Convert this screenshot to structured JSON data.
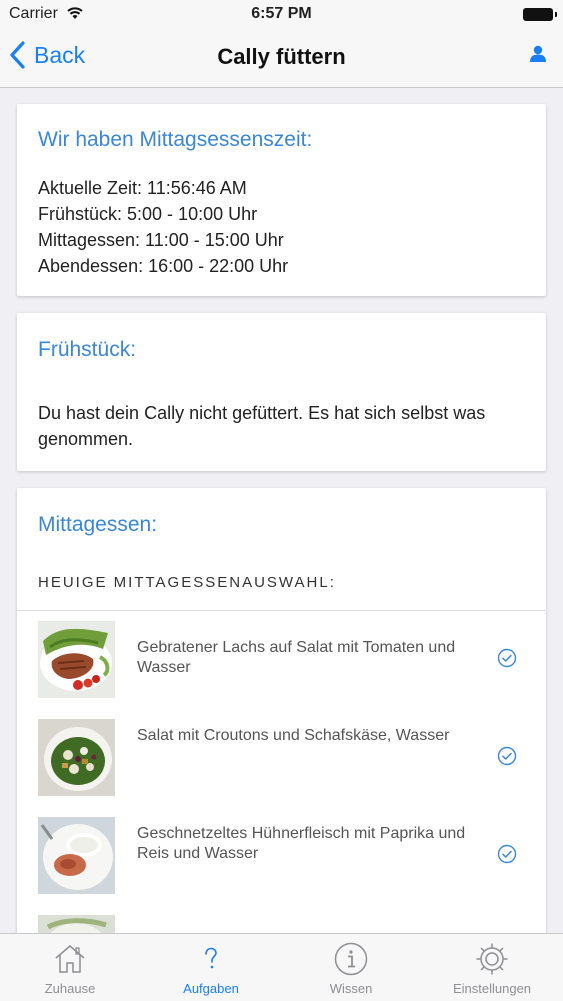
{
  "status_bar": {
    "carrier": "Carrier",
    "time": "6:57 PM"
  },
  "nav": {
    "back_label": "Back",
    "title": "Cally füttern"
  },
  "cards": {
    "time_card": {
      "title": "Wir haben Mittagsessenszeit:",
      "lines": [
        "Aktuelle Zeit: 11:56:46 AM",
        "Frühstück: 5:00 - 10:00 Uhr",
        "Mittagessen: 11:00 - 15:00 Uhr",
        "Abendessen: 16:00 - 22:00 Uhr"
      ]
    },
    "breakfast_card": {
      "title": "Frühstück:",
      "text": "Du hast dein Cally nicht gefüttert. Es hat sich selbst was genommen."
    },
    "lunch_card": {
      "title": "Mittagessen:",
      "section_header": "HEUIGE MITTAGESSENAUSWAHL:",
      "meals": [
        {
          "name": "Gebratener Lachs auf Salat mit Tomaten und Wasser"
        },
        {
          "name": "Salat mit Croutons und Schafskäse, Wasser"
        },
        {
          "name": "Geschnetzeltes Hühnerfleisch mit Paprika und Reis und Wasser"
        }
      ]
    }
  },
  "tabs": [
    {
      "label": "Zuhause",
      "icon": "home-icon"
    },
    {
      "label": "Aufgaben",
      "icon": "question-icon",
      "active": true
    },
    {
      "label": "Wissen",
      "icon": "info-icon"
    },
    {
      "label": "Einstellungen",
      "icon": "gear-icon"
    }
  ],
  "colors": {
    "accent": "#1a7ff5",
    "card_title": "#3a87d6",
    "tab_inactive": "#8e8e93"
  }
}
